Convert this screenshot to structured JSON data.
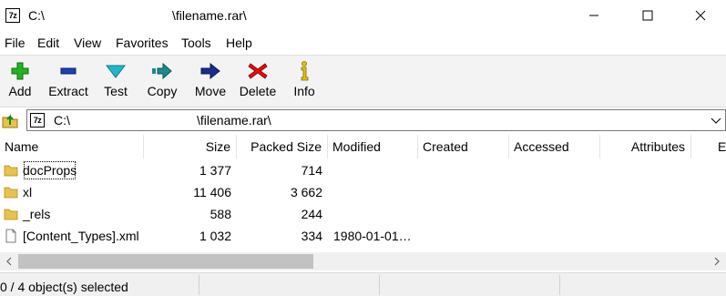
{
  "window": {
    "title_left": "C:\\",
    "title_right": "\\filename.rar\\",
    "app_icon_text": "7z"
  },
  "menu": [
    "File",
    "Edit",
    "View",
    "Favorites",
    "Tools",
    "Help"
  ],
  "toolbar": [
    {
      "label": "Add",
      "icon": "plus-icon",
      "color": "#22b422"
    },
    {
      "label": "Extract",
      "icon": "minus-icon",
      "color": "#1f3fb3"
    },
    {
      "label": "Test",
      "icon": "check-icon",
      "color": "#20b8c8"
    },
    {
      "label": "Copy",
      "icon": "copy-arrow-icon",
      "color": "#1a8a8a"
    },
    {
      "label": "Move",
      "icon": "move-arrow-icon",
      "color": "#1a2d8c"
    },
    {
      "label": "Delete",
      "icon": "delete-x-icon",
      "color": "#e01010"
    },
    {
      "label": "Info",
      "icon": "info-icon",
      "color": "#c8a800"
    }
  ],
  "address": {
    "left": "C:\\",
    "right": "\\filename.rar\\"
  },
  "columns": [
    "Name",
    "Size",
    "Packed Size",
    "Modified",
    "Created",
    "Accessed",
    "Attributes",
    "En"
  ],
  "rows": [
    {
      "name": "docProps",
      "type": "folder",
      "size": "1 377",
      "packed": "714",
      "modified": ""
    },
    {
      "name": "xl",
      "type": "folder",
      "size": "11 406",
      "packed": "3 662",
      "modified": ""
    },
    {
      "name": "_rels",
      "type": "folder",
      "size": "588",
      "packed": "244",
      "modified": ""
    },
    {
      "name": "[Content_Types].xml",
      "type": "file",
      "size": "1 032",
      "packed": "334",
      "modified": "1980-01-01…"
    }
  ],
  "status": {
    "selection": "0 / 4 object(s) selected"
  }
}
